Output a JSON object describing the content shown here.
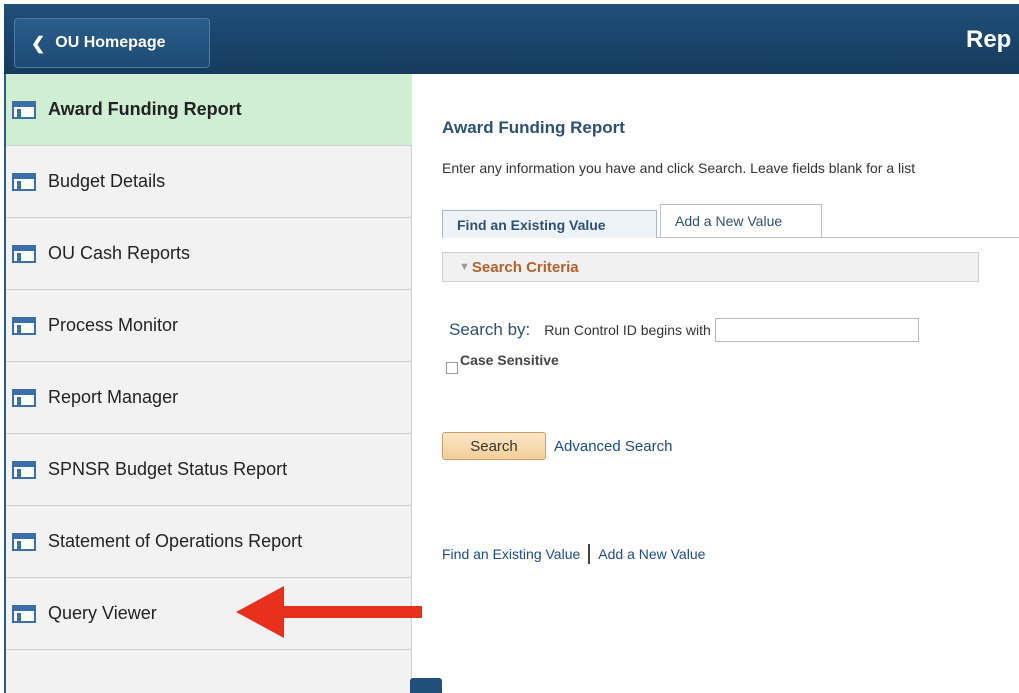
{
  "header": {
    "back_label": "OU Homepage",
    "title_partial": "Rep"
  },
  "sidebar": {
    "items": [
      {
        "label": "Award Funding Report",
        "active": true
      },
      {
        "label": "Budget Details"
      },
      {
        "label": "OU Cash Reports"
      },
      {
        "label": "Process Monitor"
      },
      {
        "label": "Report Manager"
      },
      {
        "label": "SPNSR Budget Status Report"
      },
      {
        "label": "Statement of Operations Report"
      },
      {
        "label": "Query Viewer"
      }
    ]
  },
  "main": {
    "title": "Award Funding Report",
    "instructions": "Enter any information you have and click Search. Leave fields blank for a list",
    "tabs": [
      {
        "label": "Find an Existing Value"
      },
      {
        "label": "Add a New Value"
      }
    ],
    "criteria_label": "Search Criteria",
    "search_by_label": "Search by:",
    "run_control_label": "Run Control ID begins with",
    "run_control_value": "",
    "case_sensitive_label": "Case Sensitive",
    "search_button": "Search",
    "advanced_search": "Advanced Search",
    "bottom_links": [
      "Find an Existing Value",
      "Add a New Value"
    ]
  },
  "colors": {
    "banner": "#1f4f7a",
    "active_item": "#cfeed3",
    "annotation_arrow": "#e8301c"
  }
}
